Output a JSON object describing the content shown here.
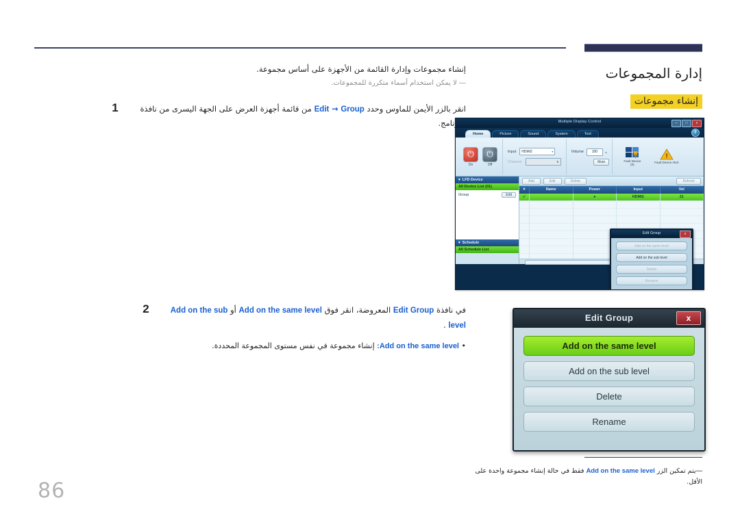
{
  "page": {
    "number": "86",
    "chapter_title": "إدارة المجموعات",
    "section_title": "إنشاء مجموعات"
  },
  "body": {
    "intro": "إنشاء مجموعات وإدارة القائمة من الأجهزة على أساس مجموعة.",
    "intro_note_dash": "―",
    "intro_note": "لا يمكن استخدام أسماء متكررة للمجموعات.",
    "steps": [
      {
        "num": "1",
        "text_before": "انقر بالزر الأيمن للماوس وحدد",
        "kw1": "Edit",
        "arrow": "→",
        "kw2": "Group",
        "text_after": "من قائمة أجهزة العرض على الجهة اليسرى من نافذة البرنامج."
      },
      {
        "num": "2",
        "text_before": "في نافذة",
        "kw1": "Edit Group",
        "text_mid": "المعروضة، انقر فوق",
        "kw2": "Add on the same level",
        "text_or": "أو",
        "kw3": "Add on the sub level",
        "text_after": "."
      }
    ],
    "bullet": {
      "dot": "•",
      "kw": "Add on the same level",
      "colon": ":",
      "text": "إنشاء مجموعة في نفس مستوى المجموعة المحددة."
    }
  },
  "bottom_note": {
    "dash": "―",
    "text_before": "يتم تمكين الزر",
    "kw": "Add on the same level",
    "text_after": "فقط في حالة إنشاء مجموعة واحدة على الأقل."
  },
  "dialog": {
    "title": "Edit Group",
    "close_label": "x",
    "buttons": [
      {
        "label": "Add on the same level",
        "state": "highlighted"
      },
      {
        "label": "Add on the sub level",
        "state": "normal"
      },
      {
        "label": "Delete",
        "state": "normal"
      },
      {
        "label": "Rename",
        "state": "normal"
      }
    ]
  },
  "mdc": {
    "window_title": "Multiple Display Control",
    "window_buttons": [
      "─",
      "□",
      "x"
    ],
    "help_label": "?",
    "tabs": [
      {
        "label": "Home",
        "active": true
      },
      {
        "label": "Picture",
        "active": false
      },
      {
        "label": "Sound",
        "active": false
      },
      {
        "label": "System",
        "active": false
      },
      {
        "label": "Tool",
        "active": false
      }
    ],
    "ribbon": {
      "power_on_label": "On",
      "power_off_label": "Off",
      "input_label": "Input",
      "input_value": "HDMI2",
      "channel_label": "Channel",
      "channel_value": "",
      "volume_label": "Volume",
      "volume_value": "100",
      "mute_label": "Mute",
      "fault_device_label": "Fault Device",
      "fault_device_count": "(0)",
      "fault_alert_label": "Fault Device Alert"
    },
    "sidebar": {
      "lfd_header": "LFD Device",
      "all_device_list": "All Device List (01)",
      "group_label": "Group",
      "edit_label": "Edit",
      "schedule_header": "Schedule",
      "all_schedule_list": "All Schedule List"
    },
    "main": {
      "toolbar_buttons": [
        "Add",
        "Edit",
        "Delete",
        "Refresh"
      ],
      "columns": [
        "#",
        "Name",
        "Power",
        "Input",
        "Vol"
      ],
      "rows": [
        {
          "check": "✓",
          "name": "",
          "power": "●",
          "input": "HDMI2",
          "vol": "21"
        }
      ]
    },
    "inner_dialog": {
      "title": "Edit Group",
      "close_label": "x",
      "buttons": [
        {
          "label": "Add on the same level",
          "enabled": false
        },
        {
          "label": "Add on the sub level",
          "enabled": true
        },
        {
          "label": "Delete",
          "enabled": false
        },
        {
          "label": "Rename",
          "enabled": false
        }
      ]
    }
  },
  "colors": {
    "accent_blue": "#1a5fd0",
    "highlight_yellow": "#f2d024",
    "rule_navy": "#2e3356",
    "dialog_green": "#7fe53f"
  }
}
